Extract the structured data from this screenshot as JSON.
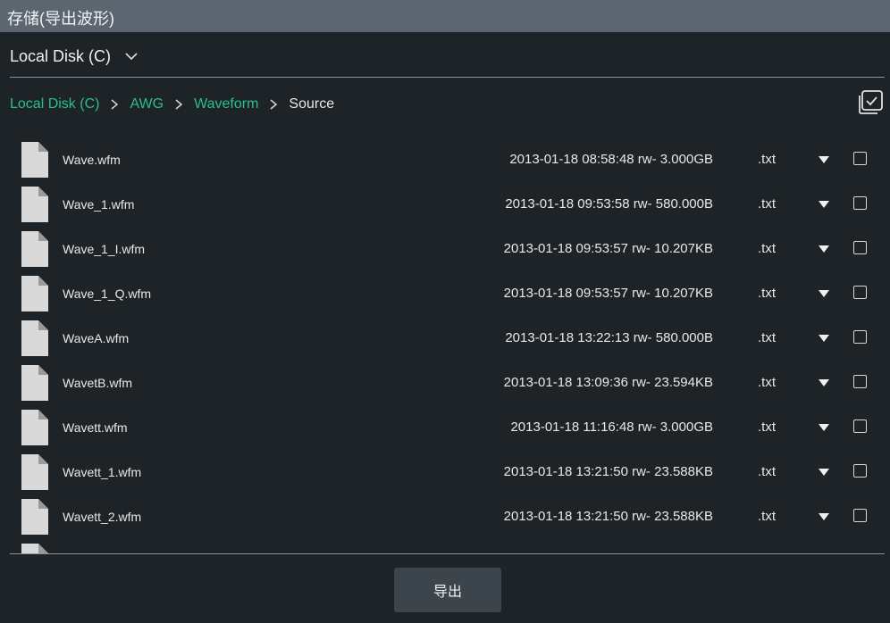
{
  "dialog": {
    "title": "存储(导出波形)"
  },
  "disk_select": {
    "label": "Local Disk (C)"
  },
  "breadcrumb": {
    "items": [
      {
        "label": "Local Disk (C)",
        "active": true
      },
      {
        "label": "AWG",
        "active": true
      },
      {
        "label": "Waveform",
        "active": true
      },
      {
        "label": "Source",
        "active": false
      }
    ]
  },
  "files": [
    {
      "name": "Wave.wfm",
      "meta": "2013-01-18 08:58:48 rw- 3.000GB",
      "ext": ".txt"
    },
    {
      "name": "Wave_1.wfm",
      "meta": "2013-01-18 09:53:58 rw- 580.000B",
      "ext": ".txt"
    },
    {
      "name": "Wave_1_I.wfm",
      "meta": "2013-01-18 09:53:57 rw- 10.207KB",
      "ext": ".txt"
    },
    {
      "name": "Wave_1_Q.wfm",
      "meta": "2013-01-18 09:53:57 rw- 10.207KB",
      "ext": ".txt"
    },
    {
      "name": "WaveA.wfm",
      "meta": "2013-01-18 13:22:13 rw- 580.000B",
      "ext": ".txt"
    },
    {
      "name": "WavetB.wfm",
      "meta": "2013-01-18 13:09:36 rw- 23.594KB",
      "ext": ".txt"
    },
    {
      "name": "Wavett.wfm",
      "meta": "2013-01-18 11:16:48 rw- 3.000GB",
      "ext": ".txt"
    },
    {
      "name": "Wavett_1.wfm",
      "meta": "2013-01-18 13:21:50 rw- 23.588KB",
      "ext": ".txt"
    },
    {
      "name": "Wavett_2.wfm",
      "meta": "2013-01-18 13:21:50 rw- 23.588KB",
      "ext": ".txt"
    },
    {
      "name": "",
      "meta": "",
      "ext": ""
    }
  ],
  "export_button": {
    "label": "导出"
  },
  "colors": {
    "background": "#1d2326",
    "titlebar": "#5b6670",
    "accent": "#2bbf8a",
    "button": "#3c454c"
  },
  "icons": {
    "file": "file-icon",
    "dropdown": "chevron-down-icon",
    "breadcrumb_separator": "chevron-right-icon",
    "select_all": "multi-select-icon",
    "row_menu": "caret-down-icon"
  }
}
